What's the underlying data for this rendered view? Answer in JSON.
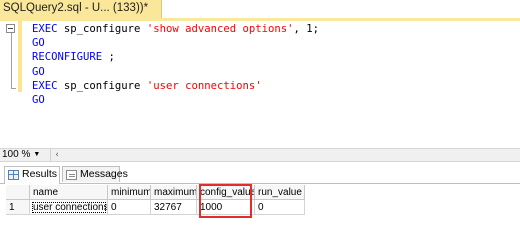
{
  "document_tab": {
    "title": "SQLQuery2.sql - U...          (133))*",
    "close_glyph": "×"
  },
  "editor": {
    "lines": [
      [
        {
          "t": "EXEC",
          "c": "kw"
        },
        {
          "t": " sp_configure ",
          "c": "plain"
        },
        {
          "t": "'show advanced options'",
          "c": "str"
        },
        {
          "t": ", 1;",
          "c": "plain"
        }
      ],
      [
        {
          "t": "GO",
          "c": "kw"
        }
      ],
      [
        {
          "t": "RECONFIGURE",
          "c": "kw"
        },
        {
          "t": " ;",
          "c": "plain"
        }
      ],
      [
        {
          "t": "GO",
          "c": "kw"
        }
      ],
      [
        {
          "t": "EXEC",
          "c": "kw"
        },
        {
          "t": " sp_configure ",
          "c": "plain"
        },
        {
          "t": "'user connections'",
          "c": "str"
        }
      ],
      [
        {
          "t": "GO",
          "c": "kw"
        }
      ]
    ]
  },
  "zoom": {
    "value": "100 %",
    "arrow": "▼"
  },
  "scroll_left_glyph": "‹",
  "results_tabs": [
    {
      "label": "Results",
      "icon": "grid-icon",
      "active": true
    },
    {
      "label": "Messages",
      "icon": "message-icon",
      "active": false
    }
  ],
  "grid": {
    "columns": [
      "",
      "name",
      "minimum",
      "maximum",
      "config_value",
      "run_value"
    ],
    "rows": [
      [
        "1",
        "user connections",
        "0",
        "32767",
        "1000",
        "0"
      ]
    ]
  },
  "colors": {
    "tab_yellow": "#fbe79a",
    "highlight_red": "#e32d2d",
    "keyword": "#0000ff",
    "string": "#ff0000"
  }
}
